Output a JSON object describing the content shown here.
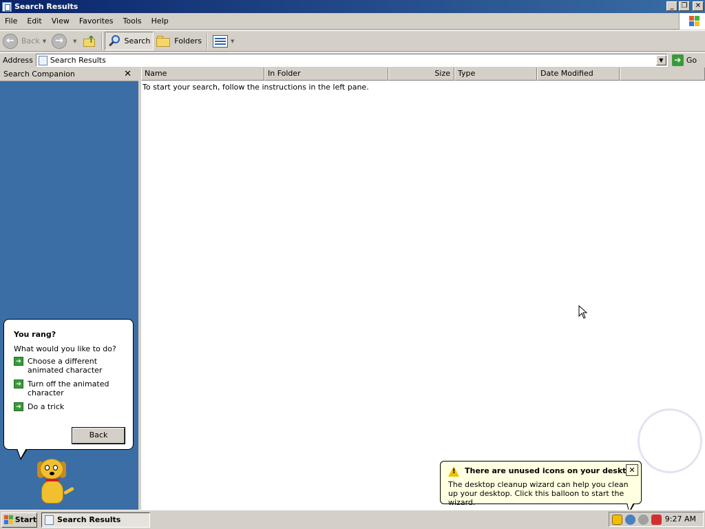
{
  "window": {
    "title": "Search Results",
    "controls": {
      "minimize": "_",
      "restore": "❐",
      "close": "✕"
    }
  },
  "menubar": {
    "items": [
      "File",
      "Edit",
      "View",
      "Favorites",
      "Tools",
      "Help"
    ]
  },
  "toolbar": {
    "back_label": "Back",
    "search_label": "Search",
    "folders_label": "Folders"
  },
  "address": {
    "label": "Address",
    "value": "Search Results",
    "go_label": "Go"
  },
  "search_companion": {
    "header": "Search Companion",
    "close": "✕",
    "balloon": {
      "title": "You rang?",
      "question": "What would you like to do?",
      "options": [
        "Choose a different animated character",
        "Turn off the animated character",
        "Do a trick"
      ],
      "back_label": "Back"
    }
  },
  "results": {
    "columns": [
      "Name",
      "In Folder",
      "Size",
      "Type",
      "Date Modified"
    ],
    "instructions": "To start your search, follow the instructions in the left pane."
  },
  "notification": {
    "title": "There are unused icons on your desktop",
    "body": "The desktop cleanup wizard can help you clean up your desktop. Click this balloon to start the wizard.",
    "close": "✕"
  },
  "taskbar": {
    "start_label": "Start",
    "task_label": "Search Results",
    "clock": "9:27 AM",
    "tray_icons": [
      "security-shield-icon",
      "network-icon",
      "security-center-icon",
      "antivirus-icon"
    ]
  },
  "colors": {
    "titlebar_start": "#0a246a",
    "titlebar_end": "#3a6ea5",
    "left_pane": "#3a6ea5",
    "balloon_bg": "#ffffe1"
  }
}
